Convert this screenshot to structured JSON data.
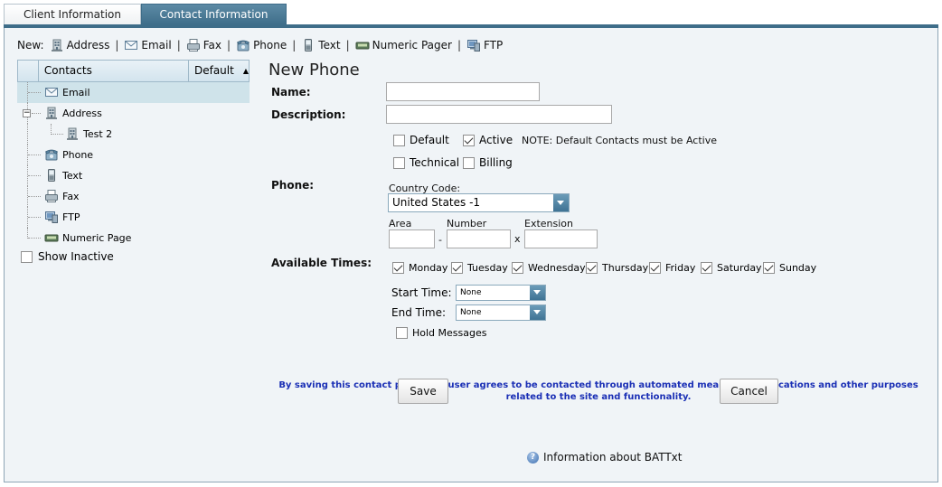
{
  "tabs": [
    {
      "label": "Client Information",
      "active": false
    },
    {
      "label": "Contact Information",
      "active": true
    }
  ],
  "new_bar": {
    "label": "New:",
    "items": [
      {
        "label": "Address",
        "icon": "building-icon"
      },
      {
        "label": "Email",
        "icon": "envelope-icon"
      },
      {
        "label": "Fax",
        "icon": "fax-icon"
      },
      {
        "label": "Phone",
        "icon": "phone-icon"
      },
      {
        "label": "Text",
        "icon": "mobile-icon"
      },
      {
        "label": "Numeric Pager",
        "icon": "pager-icon"
      },
      {
        "label": "FTP",
        "icon": "ftp-icon"
      }
    ],
    "separator": "|"
  },
  "contacts_tree": {
    "header_contacts": "Contacts",
    "header_default": "Default",
    "sort_arrow": "▲",
    "items": [
      {
        "label": "Email",
        "icon": "envelope-icon",
        "selected": true
      },
      {
        "label": "Address",
        "icon": "building-icon",
        "expanded": true
      },
      {
        "label": "Test 2",
        "icon": "building-icon"
      },
      {
        "label": "Phone",
        "icon": "phone-icon"
      },
      {
        "label": "Text",
        "icon": "mobile-icon"
      },
      {
        "label": "Fax",
        "icon": "fax-icon"
      },
      {
        "label": "FTP",
        "icon": "ftp-icon"
      },
      {
        "label": "Numeric Page",
        "icon": "pager-icon"
      }
    ],
    "expander_symbol": "−",
    "show_inactive_label": "Show Inactive"
  },
  "form": {
    "title": "New Phone",
    "name_label": "Name:",
    "name_value": "",
    "description_label": "Description:",
    "description_value": "",
    "flags": {
      "default_label": "Default",
      "default_checked": false,
      "active_label": "Active",
      "active_checked": true,
      "note": "NOTE: Default Contacts must be Active",
      "technical_label": "Technical",
      "technical_checked": false,
      "billing_label": "Billing",
      "billing_checked": false
    },
    "phone_label": "Phone:",
    "country_code_label": "Country Code:",
    "country_code_value": "United States -1",
    "area_label": "Area",
    "number_label": "Number",
    "extension_label": "Extension",
    "dash": "-",
    "x": "x",
    "available_times_label": "Available Times:",
    "days": [
      {
        "label": "Monday",
        "checked": true
      },
      {
        "label": "Tuesday",
        "checked": true
      },
      {
        "label": "Wednesday",
        "checked": true
      },
      {
        "label": "Thursday",
        "checked": true
      },
      {
        "label": "Friday",
        "checked": true
      },
      {
        "label": "Saturday",
        "checked": true
      },
      {
        "label": "Sunday",
        "checked": true
      }
    ],
    "start_time_label": "Start Time:",
    "start_time_value": "None",
    "end_time_label": "End Time:",
    "end_time_value": "None",
    "hold_messages_label": "Hold Messages",
    "hold_messages_checked": false,
    "notice": "By saving this contact point, the user agrees to be contacted through automated means for notifications and other purposes related to the site and functionality.",
    "save_label": "Save",
    "cancel_label": "Cancel"
  },
  "info_link": "Information about BATTxt",
  "colors": {
    "tab_active": "#3e6d89",
    "panel_bg": "#f0f4f7",
    "selected_row": "#cfe3ea",
    "notice_text": "#1a2fb5"
  }
}
